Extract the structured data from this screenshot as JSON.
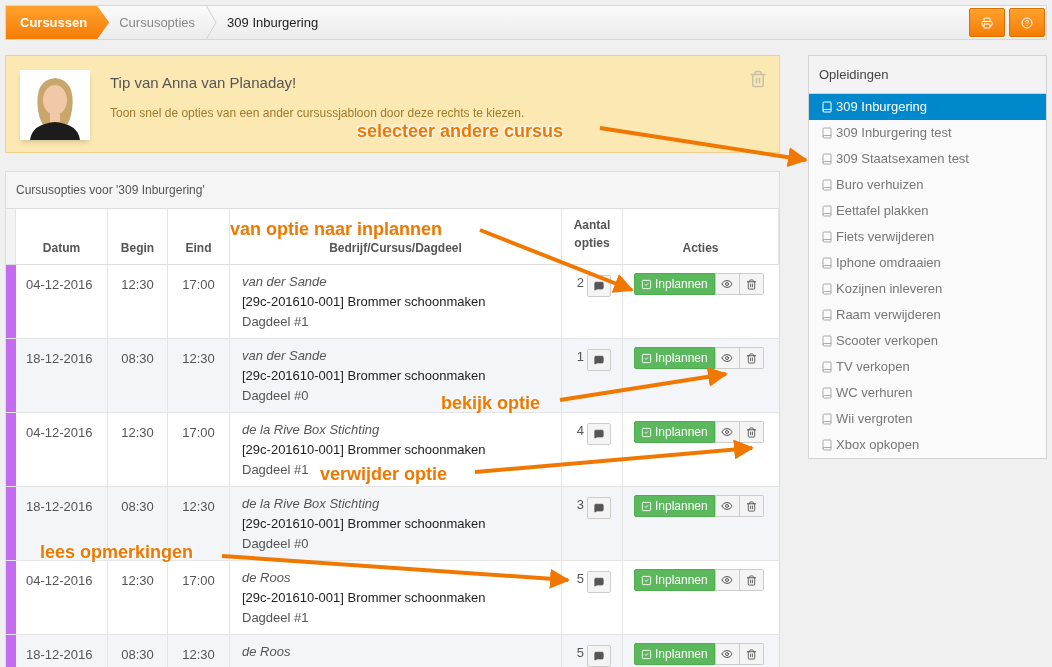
{
  "breadcrumb": [
    {
      "label": "Cursussen",
      "selected": true
    },
    {
      "label": "Cursusopties",
      "selected": false
    },
    {
      "label": "309 Inburgering",
      "selected": false
    }
  ],
  "tip": {
    "title": "Tip van Anna van Planaday!",
    "text": "Toon snel de opties van een ander cursussjabloon door deze rechts te kiezen."
  },
  "options_panel": {
    "title": "Cursusopties voor '309 Inburgering'",
    "columns": [
      "Datum",
      "Begin",
      "Eind",
      "Bedrijf/Cursus/Dagdeel",
      "Aantal opties",
      "Acties"
    ],
    "rows": [
      {
        "date": "04-12-2016",
        "begin": "12:30",
        "end": "17:00",
        "company": "van der Sande",
        "course": "[29c-201610-001] Brommer schoonmaken",
        "part": "Dagdeel #1",
        "count": "2",
        "action": "Inplannen"
      },
      {
        "date": "18-12-2016",
        "begin": "08:30",
        "end": "12:30",
        "company": "van der Sande",
        "course": "[29c-201610-001] Brommer schoonmaken",
        "part": "Dagdeel #0",
        "count": "1",
        "action": "Inplannen"
      },
      {
        "date": "04-12-2016",
        "begin": "12:30",
        "end": "17:00",
        "company": "de la Rive Box Stichting",
        "course": "[29c-201610-001] Brommer schoonmaken",
        "part": "Dagdeel #1",
        "count": "4",
        "action": "Inplannen"
      },
      {
        "date": "18-12-2016",
        "begin": "08:30",
        "end": "12:30",
        "company": "de la Rive Box Stichting",
        "course": "[29c-201610-001] Brommer schoonmaken",
        "part": "Dagdeel #0",
        "count": "3",
        "action": "Inplannen"
      },
      {
        "date": "04-12-2016",
        "begin": "12:30",
        "end": "17:00",
        "company": "de Roos",
        "course": "[29c-201610-001] Brommer schoonmaken",
        "part": "Dagdeel #1",
        "count": "5",
        "action": "Inplannen"
      },
      {
        "date": "18-12-2016",
        "begin": "08:30",
        "end": "12:30",
        "company": "de Roos",
        "count": "5",
        "action": "Inplannen"
      }
    ]
  },
  "sidebar": {
    "title": "Opleidingen",
    "items": [
      {
        "label": "309 Inburgering",
        "selected": true
      },
      {
        "label": "309 Inburgering test",
        "selected": false
      },
      {
        "label": "309 Staatsexamen test",
        "selected": false
      },
      {
        "label": "Buro verhuizen",
        "selected": false
      },
      {
        "label": "Eettafel plakken",
        "selected": false
      },
      {
        "label": "Fiets verwijderen",
        "selected": false
      },
      {
        "label": "Iphone omdraaien",
        "selected": false
      },
      {
        "label": "Kozijnen inleveren",
        "selected": false
      },
      {
        "label": "Raam verwijderen",
        "selected": false
      },
      {
        "label": "Scooter verkopen",
        "selected": false
      },
      {
        "label": "TV verkopen",
        "selected": false
      },
      {
        "label": "WC verhuren",
        "selected": false
      },
      {
        "label": "Wii vergroten",
        "selected": false
      },
      {
        "label": "Xbox opkopen",
        "selected": false
      }
    ]
  },
  "annotations": [
    {
      "text": "selecteer andere cursus"
    },
    {
      "text": "van optie naar inplannen"
    },
    {
      "text": "bekijk optie"
    },
    {
      "text": "verwijder optie"
    },
    {
      "text": "lees opmerkingen"
    }
  ]
}
